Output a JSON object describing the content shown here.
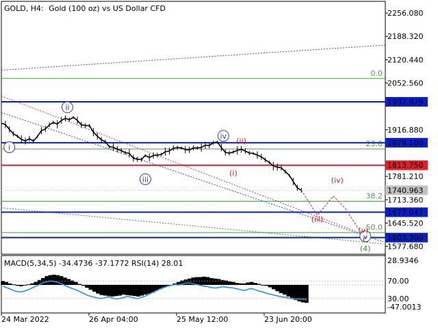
{
  "header": {
    "symbol": "GOLD, H4:",
    "description": "Gold (100 oz) vs US Dollar CFD"
  },
  "macd_header": {
    "label": "MACD(5,34,5) -34.4736 -37.1772 RSI(14) 28.01"
  },
  "colors": {
    "price": "#000000",
    "blue_level": "#0a1fc8",
    "red_level": "#e51c23",
    "fib_green": "#4f9a4f",
    "trend_purple": "#6a3ab8",
    "trend_red": "#d43a3a",
    "trend_green": "#3d8f3d",
    "trend_blue": "#3040d0",
    "wave_blue": "#2f3fb5",
    "wave_red": "#cc2222",
    "wave_green": "#2e8b2e",
    "macd_hist": "#000000",
    "rsi_line": "#1e90ff"
  },
  "chart_data": {
    "type": "line",
    "title": "GOLD, H4: Gold (100 oz) vs US Dollar CFD",
    "ylim": [
      1555,
      2290
    ],
    "y_ticks": [
      "2256.080",
      "2188.320",
      "2120.440",
      "2052.560",
      "1916.880",
      "1781.210",
      "1713.360",
      "1645.520",
      "1577.680"
    ],
    "x_ticks": [
      "24 Mar 2022",
      "26 Apr 04:00",
      "25 May 12:00",
      "23 Jun 20:00"
    ],
    "price_labels": [
      {
        "text": "1997.979",
        "value": 1998.0,
        "kind": "blue"
      },
      {
        "text": "1879.100",
        "value": 1879.1,
        "kind": "blue"
      },
      {
        "text": "1813.750",
        "value": 1813.75,
        "kind": "red"
      },
      {
        "text": "1740.963",
        "value": 1741.0,
        "kind": "current"
      },
      {
        "text": "1677.047",
        "value": 1677.05,
        "kind": "blue"
      },
      {
        "text": "1603.300",
        "value": 1603.3,
        "kind": "blue"
      }
    ],
    "fib_levels": [
      {
        "label": "0.0",
        "value": 2066
      },
      {
        "label": "23.6",
        "value": 1861
      },
      {
        "label": "38.2",
        "value": 1709
      },
      {
        "label": "50.0",
        "value": 1618
      }
    ],
    "price_series": [
      [
        0,
        1936
      ],
      [
        2,
        1932
      ],
      [
        4,
        1918
      ],
      [
        6,
        1905
      ],
      [
        8,
        1898
      ],
      [
        10,
        1889
      ],
      [
        12,
        1884
      ],
      [
        14,
        1891
      ],
      [
        16,
        1884
      ],
      [
        18,
        1897
      ],
      [
        20,
        1914
      ],
      [
        22,
        1919
      ],
      [
        24,
        1931
      ],
      [
        26,
        1938
      ],
      [
        28,
        1933
      ],
      [
        30,
        1944
      ],
      [
        32,
        1950
      ],
      [
        34,
        1946
      ],
      [
        36,
        1953
      ],
      [
        38,
        1944
      ],
      [
        40,
        1931
      ],
      [
        42,
        1929
      ],
      [
        44,
        1929
      ],
      [
        46,
        1910
      ],
      [
        48,
        1898
      ],
      [
        50,
        1888
      ],
      [
        52,
        1882
      ],
      [
        54,
        1867
      ],
      [
        56,
        1866
      ],
      [
        58,
        1860
      ],
      [
        60,
        1856
      ],
      [
        62,
        1850
      ],
      [
        64,
        1848
      ],
      [
        66,
        1834
      ],
      [
        68,
        1831
      ],
      [
        70,
        1830
      ],
      [
        72,
        1842
      ],
      [
        74,
        1836
      ],
      [
        76,
        1842
      ],
      [
        78,
        1843
      ],
      [
        80,
        1845
      ],
      [
        82,
        1853
      ],
      [
        84,
        1855
      ],
      [
        86,
        1863
      ],
      [
        88,
        1865
      ],
      [
        90,
        1864
      ],
      [
        92,
        1859
      ],
      [
        94,
        1858
      ],
      [
        96,
        1864
      ],
      [
        98,
        1864
      ],
      [
        100,
        1865
      ],
      [
        102,
        1872
      ],
      [
        104,
        1871
      ],
      [
        106,
        1879
      ],
      [
        108,
        1881
      ],
      [
        110,
        1865
      ],
      [
        112,
        1851
      ],
      [
        114,
        1849
      ],
      [
        116,
        1852
      ],
      [
        118,
        1857
      ],
      [
        120,
        1860
      ],
      [
        122,
        1855
      ],
      [
        124,
        1849
      ],
      [
        126,
        1848
      ],
      [
        128,
        1843
      ],
      [
        130,
        1838
      ],
      [
        132,
        1829
      ],
      [
        134,
        1822
      ],
      [
        136,
        1811
      ],
      [
        138,
        1808
      ],
      [
        140,
        1806
      ],
      [
        142,
        1795
      ],
      [
        144,
        1784
      ],
      [
        146,
        1766
      ],
      [
        148,
        1748
      ],
      [
        150,
        1741
      ]
    ],
    "projection": [
      [
        150,
        1741
      ],
      [
        158,
        1668
      ],
      [
        166,
        1724
      ],
      [
        172,
        1688
      ],
      [
        178,
        1634
      ],
      [
        182,
        1606
      ]
    ],
    "wave_labels": [
      {
        "text": "i",
        "x": 4,
        "y": 1866,
        "style": "blue-circle"
      },
      {
        "text": "ii",
        "x": 33,
        "y": 1982,
        "style": "blue-circle"
      },
      {
        "text": "iii",
        "x": 72,
        "y": 1773,
        "style": "blue-circle"
      },
      {
        "text": "iv",
        "x": 111,
        "y": 1899,
        "style": "blue-circle"
      },
      {
        "text": "v",
        "x": 182,
        "y": 1607,
        "style": "blue-circle"
      },
      {
        "text": "(ii)",
        "x": 120,
        "y": 1885,
        "style": "red"
      },
      {
        "text": "(i)",
        "x": 116,
        "y": 1791,
        "style": "red"
      },
      {
        "text": "(iii)",
        "x": 158,
        "y": 1657,
        "style": "red"
      },
      {
        "text": "(iv)",
        "x": 168,
        "y": 1771,
        "style": "red"
      },
      {
        "text": "(v)",
        "x": 181,
        "y": 1626,
        "style": "red"
      },
      {
        "text": "C",
        "x": 182,
        "y": 1598,
        "style": "red"
      },
      {
        "text": "(4)",
        "x": 182,
        "y": 1572,
        "style": "green"
      }
    ],
    "trendlines": [
      {
        "color": "purple",
        "from": [
          0,
          2090
        ],
        "to": [
          192,
          2163
        ]
      },
      {
        "color": "red",
        "from": [
          0,
          2015
        ],
        "to": [
          178,
          1620
        ]
      },
      {
        "color": "blue",
        "from": [
          0,
          1967
        ],
        "to": [
          191,
          1591
        ]
      },
      {
        "color": "green",
        "from": [
          0,
          1690
        ],
        "to": [
          191,
          1585
        ]
      }
    ],
    "macd": {
      "labels": [
        "28.9346",
        "70.00",
        "30.00",
        "-47.0013"
      ],
      "ylim": [
        -55,
        35
      ],
      "hist": [
        8,
        6,
        3,
        1,
        -2,
        -3,
        -1,
        1,
        3,
        6,
        10,
        14,
        18,
        20,
        21,
        20,
        18,
        15,
        12,
        9,
        6,
        2,
        -2,
        -6,
        -10,
        -14,
        -18,
        -21,
        -22,
        -23,
        -24,
        -23,
        -22,
        -20,
        -21,
        -22,
        -23,
        -24,
        -22,
        -20,
        -18,
        -16,
        -12,
        -9,
        -6,
        -3,
        0,
        3,
        6,
        9,
        11,
        13,
        15,
        16,
        16,
        17,
        16,
        14,
        13,
        12,
        10,
        9,
        7,
        6,
        4,
        3,
        3,
        5,
        6,
        4,
        2,
        0,
        -2,
        -5,
        -9,
        -13,
        -17,
        -20,
        -24,
        -28,
        -31,
        -34,
        -36,
        -37
      ],
      "rsi": [
        58,
        55,
        52,
        48,
        46,
        45,
        47,
        50,
        54,
        58,
        62,
        66,
        68,
        70,
        69,
        67,
        64,
        60,
        56,
        53,
        50,
        46,
        42,
        38,
        35,
        33,
        31,
        30,
        32,
        34,
        31,
        29,
        30,
        32,
        35,
        33,
        31,
        30,
        33,
        36,
        40,
        44,
        48,
        52,
        55,
        58,
        60,
        62,
        61,
        63,
        65,
        66,
        64,
        62,
        60,
        58,
        57,
        55,
        54,
        55,
        57,
        56,
        55,
        54,
        52,
        50,
        48,
        51,
        53,
        50,
        47,
        45,
        42,
        40,
        38,
        36,
        34,
        33,
        31,
        30,
        29,
        29,
        28,
        28
      ]
    }
  }
}
